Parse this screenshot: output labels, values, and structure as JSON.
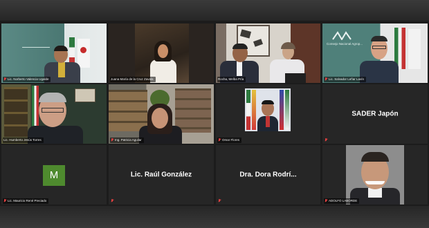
{
  "meeting": {
    "participants": [
      {
        "name": "Lic. Norberto Valencia Ugalde",
        "muted": true,
        "video": true
      },
      {
        "name": "Juana María de la Cruz Zavala",
        "muted": false,
        "video": true
      },
      {
        "name": "Rocha, Melba Pría",
        "muted": false,
        "video": true
      },
      {
        "name": "Lic. Salvador Leñar Lavín",
        "muted": false,
        "video": true
      },
      {
        "name": "Lic. Humberto Jesús Torres",
        "muted": false,
        "video": true,
        "active_speaker": true
      },
      {
        "name": "Ing. Patricia Aguilar",
        "muted": true,
        "video": true
      },
      {
        "name": "Omar Flores",
        "muted": true,
        "video": true
      },
      {
        "name": "SADER Japón",
        "display_name": "SADER Japón",
        "muted": true,
        "video": false
      },
      {
        "name": "Lic. Mauricio René Preciado",
        "initial": "M",
        "muted": true,
        "video": false
      },
      {
        "name": "Lic. Raúl González",
        "display_name": "Lic. Raúl González",
        "muted": true,
        "video": false
      },
      {
        "name": "Dra. Dora Rodrí...",
        "display_name": "Dra. Dora Rodrí...",
        "muted": true,
        "video": false
      },
      {
        "name": "ADOLFO LABORDE",
        "muted": true,
        "video": true
      }
    ],
    "logos": {
      "consejo": "Consejo Nacional Agrop..."
    },
    "colors": {
      "active_border": "#9acd32",
      "avatar_bg": "#4e8a2e",
      "mic_muted": "#e04040"
    }
  }
}
